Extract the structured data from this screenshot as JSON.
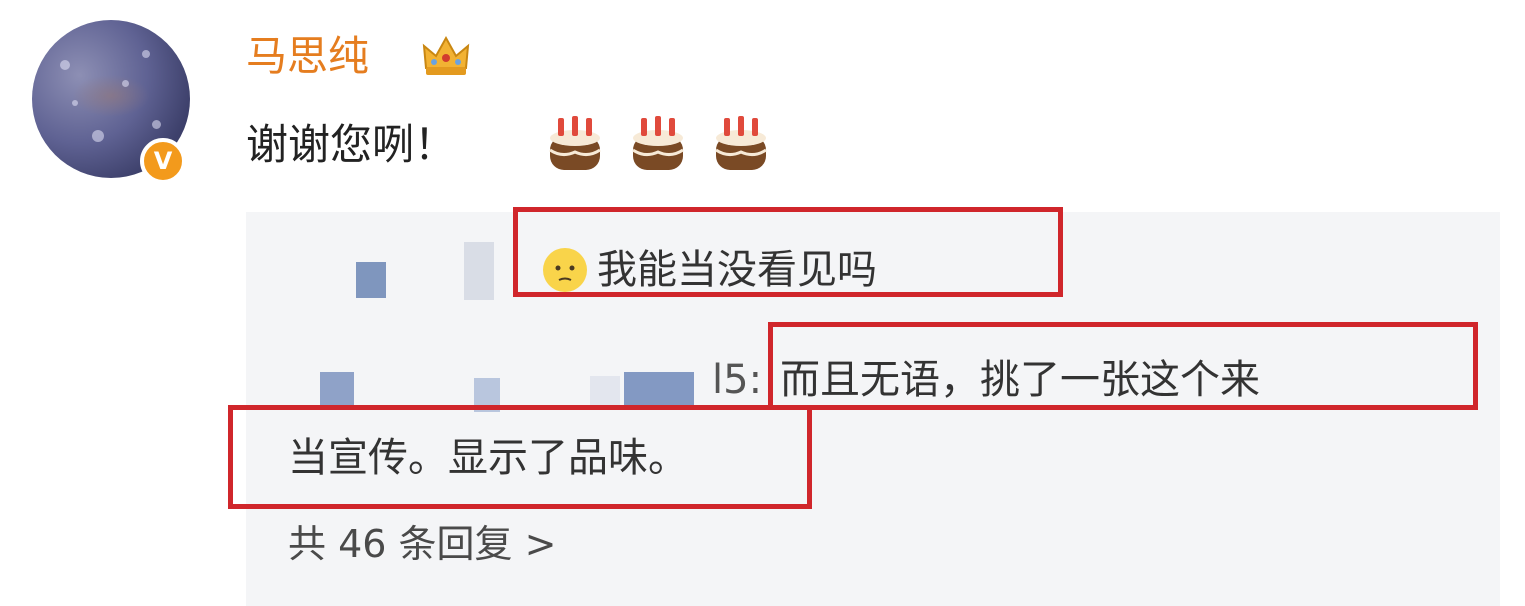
{
  "post": {
    "username": "马思纯",
    "comment_text": "谢谢您咧！",
    "cake_emoji_count": 3
  },
  "replies": {
    "reply1_text": "我能当没看见吗",
    "reply2_prefix": "l5:",
    "reply2_text": "而且无语，挑了一张这个来",
    "reply2_continuation": "当宣传。显示了品味。",
    "more_replies": "共 46 条回复 >"
  },
  "colors": {
    "username": "#e57d1f",
    "verified_badge": "#f39a1c",
    "highlight_box": "#d0262b",
    "reply_background": "#f4f5f7"
  },
  "icons": [
    "crown-icon",
    "cake-emoji",
    "face-emoji",
    "verified-badge-icon"
  ]
}
